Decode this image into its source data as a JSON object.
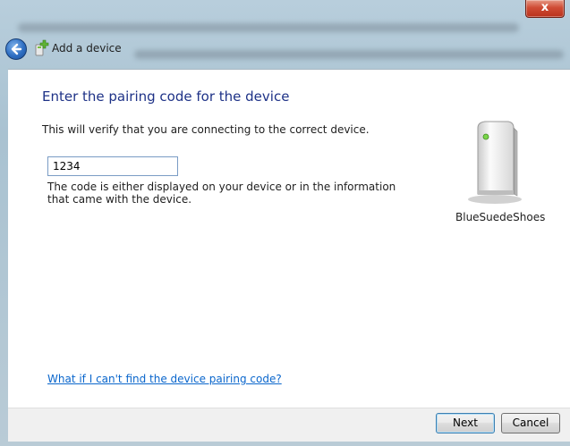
{
  "window": {
    "title": "Add a device",
    "close_symbol": "x"
  },
  "page": {
    "heading": "Enter the pairing code for the device",
    "description": "This will verify that you are connecting to the correct device.",
    "code_value": "1234",
    "hint": "The code is either displayed on your device or in the information that came with the device.",
    "help_link": "What if I can't find the device pairing code?"
  },
  "device": {
    "name": "BlueSuedeShoes",
    "icon": "device-tower-icon"
  },
  "buttons": {
    "next": "Next",
    "cancel": "Cancel"
  },
  "colors": {
    "heading": "#1e3287",
    "link": "#0a66cc",
    "close": "#cf4c34"
  }
}
